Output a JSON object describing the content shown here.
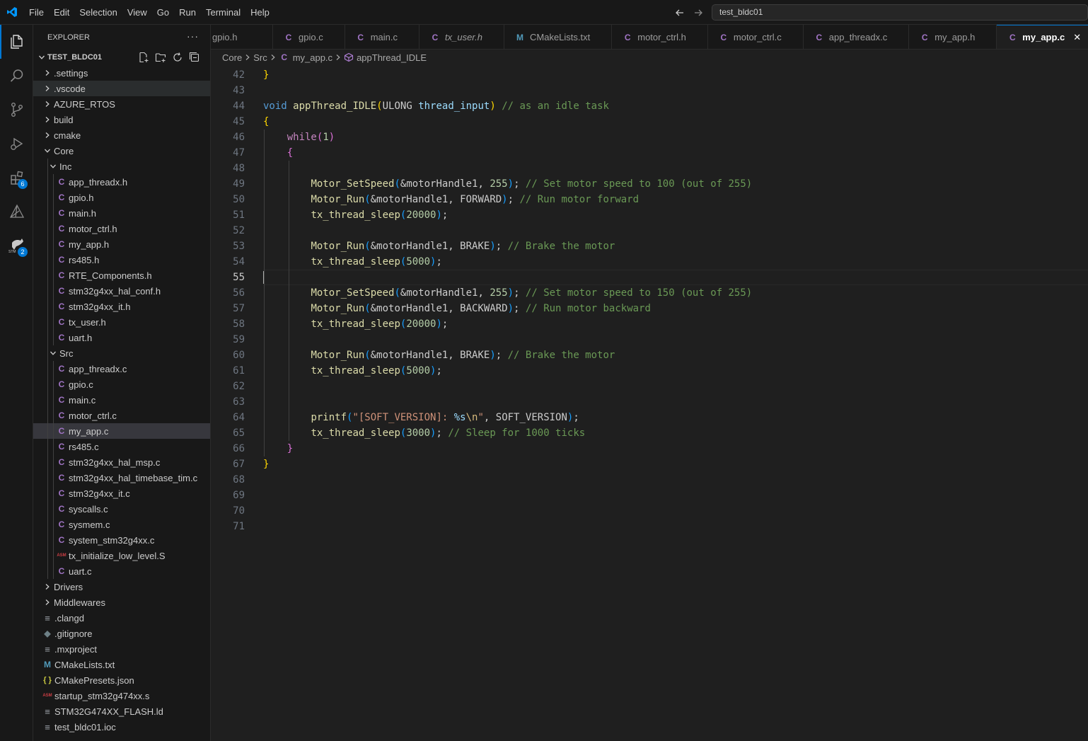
{
  "menu": [
    "File",
    "Edit",
    "Selection",
    "View",
    "Go",
    "Run",
    "Terminal",
    "Help"
  ],
  "search": {
    "value": "test_bldc01"
  },
  "activity": {
    "extensions_badge": "6",
    "stm_badge": "2"
  },
  "explorer": {
    "title": "EXPLORER",
    "more": "···",
    "root": "TEST_BLDC01",
    "items": [
      {
        "name": ".settings",
        "kind": "folder",
        "depth": 0,
        "open": false
      },
      {
        "name": ".vscode",
        "kind": "folder",
        "depth": 0,
        "open": false
      },
      {
        "name": "AZURE_RTOS",
        "kind": "folder",
        "depth": 0,
        "open": false
      },
      {
        "name": "build",
        "kind": "folder",
        "depth": 0,
        "open": false
      },
      {
        "name": "cmake",
        "kind": "folder",
        "depth": 0,
        "open": false
      },
      {
        "name": "Core",
        "kind": "folder",
        "depth": 0,
        "open": true
      },
      {
        "name": "Inc",
        "kind": "folder",
        "depth": 1,
        "open": true
      },
      {
        "name": "app_threadx.h",
        "kind": "c",
        "depth": 2
      },
      {
        "name": "gpio.h",
        "kind": "c",
        "depth": 2
      },
      {
        "name": "main.h",
        "kind": "c",
        "depth": 2
      },
      {
        "name": "motor_ctrl.h",
        "kind": "c",
        "depth": 2
      },
      {
        "name": "my_app.h",
        "kind": "c",
        "depth": 2
      },
      {
        "name": "rs485.h",
        "kind": "c",
        "depth": 2
      },
      {
        "name": "RTE_Components.h",
        "kind": "c",
        "depth": 2
      },
      {
        "name": "stm32g4xx_hal_conf.h",
        "kind": "c",
        "depth": 2
      },
      {
        "name": "stm32g4xx_it.h",
        "kind": "c",
        "depth": 2
      },
      {
        "name": "tx_user.h",
        "kind": "c",
        "depth": 2
      },
      {
        "name": "uart.h",
        "kind": "c",
        "depth": 2
      },
      {
        "name": "Src",
        "kind": "folder",
        "depth": 1,
        "open": true
      },
      {
        "name": "app_threadx.c",
        "kind": "c",
        "depth": 2
      },
      {
        "name": "gpio.c",
        "kind": "c",
        "depth": 2
      },
      {
        "name": "main.c",
        "kind": "c",
        "depth": 2
      },
      {
        "name": "motor_ctrl.c",
        "kind": "c",
        "depth": 2
      },
      {
        "name": "my_app.c",
        "kind": "c",
        "depth": 2,
        "selected": true
      },
      {
        "name": "rs485.c",
        "kind": "c",
        "depth": 2
      },
      {
        "name": "stm32g4xx_hal_msp.c",
        "kind": "c",
        "depth": 2
      },
      {
        "name": "stm32g4xx_hal_timebase_tim.c",
        "kind": "c",
        "depth": 2
      },
      {
        "name": "stm32g4xx_it.c",
        "kind": "c",
        "depth": 2
      },
      {
        "name": "syscalls.c",
        "kind": "c",
        "depth": 2
      },
      {
        "name": "sysmem.c",
        "kind": "c",
        "depth": 2
      },
      {
        "name": "system_stm32g4xx.c",
        "kind": "c",
        "depth": 2
      },
      {
        "name": "tx_initialize_low_level.S",
        "kind": "asm",
        "depth": 2
      },
      {
        "name": "uart.c",
        "kind": "c",
        "depth": 2
      },
      {
        "name": "Drivers",
        "kind": "folder",
        "depth": 0,
        "open": false
      },
      {
        "name": "Middlewares",
        "kind": "folder",
        "depth": 0,
        "open": false
      },
      {
        "name": ".clangd",
        "kind": "lines",
        "depth": 0
      },
      {
        "name": ".gitignore",
        "kind": "git",
        "depth": 0
      },
      {
        "name": ".mxproject",
        "kind": "lines",
        "depth": 0
      },
      {
        "name": "CMakeLists.txt",
        "kind": "m",
        "depth": 0
      },
      {
        "name": "CMakePresets.json",
        "kind": "json",
        "depth": 0
      },
      {
        "name": "startup_stm32g474xx.s",
        "kind": "asm",
        "depth": 0
      },
      {
        "name": "STM32G474XX_FLASH.ld",
        "kind": "lines",
        "depth": 0
      },
      {
        "name": "test_bldc01.ioc",
        "kind": "lines",
        "depth": 0
      }
    ]
  },
  "tabs": [
    {
      "label": "gpio.h",
      "kind": "none"
    },
    {
      "label": "gpio.c",
      "kind": "c"
    },
    {
      "label": "main.c",
      "kind": "c"
    },
    {
      "label": "tx_user.h",
      "kind": "c",
      "italic": true
    },
    {
      "label": "CMakeLists.txt",
      "kind": "m"
    },
    {
      "label": "motor_ctrl.h",
      "kind": "c"
    },
    {
      "label": "motor_ctrl.c",
      "kind": "c"
    },
    {
      "label": "app_threadx.c",
      "kind": "c"
    },
    {
      "label": "my_app.h",
      "kind": "c"
    },
    {
      "label": "my_app.c",
      "kind": "c",
      "active": true
    }
  ],
  "breadcrumb": [
    "Core",
    "Src",
    "my_app.c",
    "appThread_IDLE"
  ],
  "editor": {
    "current_line": 55,
    "lines": [
      {
        "n": "42",
        "tokens": [
          [
            "p1",
            "}"
          ]
        ]
      },
      {
        "n": "43",
        "tokens": []
      },
      {
        "n": "44",
        "tokens": [
          [
            "kw",
            "void"
          ],
          [
            "",
            " "
          ],
          [
            "fn",
            "appThread_IDLE"
          ],
          [
            "p1",
            "("
          ],
          [
            "",
            "ULONG "
          ],
          [
            "var",
            "thread_input"
          ],
          [
            "p1",
            ")"
          ],
          [
            "",
            " "
          ],
          [
            "cmt",
            "// as an idle task"
          ]
        ]
      },
      {
        "n": "45",
        "tokens": [
          [
            "p1",
            "{"
          ]
        ]
      },
      {
        "n": "46",
        "tokens": [
          [
            "",
            "    "
          ],
          [
            "ctrl",
            "while"
          ],
          [
            "p2",
            "("
          ],
          [
            "num",
            "1"
          ],
          [
            "p2",
            ")"
          ]
        ]
      },
      {
        "n": "47",
        "tokens": [
          [
            "",
            "    "
          ],
          [
            "p2",
            "{"
          ]
        ]
      },
      {
        "n": "48",
        "tokens": []
      },
      {
        "n": "49",
        "tokens": [
          [
            "",
            "        "
          ],
          [
            "fn",
            "Motor_SetSpeed"
          ],
          [
            "p3",
            "("
          ],
          [
            "",
            "&motorHandle1, "
          ],
          [
            "num",
            "255"
          ],
          [
            "p3",
            ")"
          ],
          [
            "",
            "; "
          ],
          [
            "cmt",
            "// Set motor speed to 100 (out of 255)"
          ]
        ]
      },
      {
        "n": "50",
        "tokens": [
          [
            "",
            "        "
          ],
          [
            "fn",
            "Motor_Run"
          ],
          [
            "p3",
            "("
          ],
          [
            "",
            "&motorHandle1, FORWARD"
          ],
          [
            "p3",
            ")"
          ],
          [
            "",
            "; "
          ],
          [
            "cmt",
            "// Run motor forward"
          ]
        ]
      },
      {
        "n": "51",
        "tokens": [
          [
            "",
            "        "
          ],
          [
            "fn",
            "tx_thread_sleep"
          ],
          [
            "p3",
            "("
          ],
          [
            "num",
            "20000"
          ],
          [
            "p3",
            ")"
          ],
          [
            "",
            ";"
          ]
        ]
      },
      {
        "n": "52",
        "tokens": []
      },
      {
        "n": "53",
        "tokens": [
          [
            "",
            "        "
          ],
          [
            "fn",
            "Motor_Run"
          ],
          [
            "p3",
            "("
          ],
          [
            "",
            "&motorHandle1, BRAKE"
          ],
          [
            "p3",
            ")"
          ],
          [
            "",
            "; "
          ],
          [
            "cmt",
            "// Brake the motor"
          ]
        ]
      },
      {
        "n": "54",
        "tokens": [
          [
            "",
            "        "
          ],
          [
            "fn",
            "tx_thread_sleep"
          ],
          [
            "p3",
            "("
          ],
          [
            "num",
            "5000"
          ],
          [
            "p3",
            ")"
          ],
          [
            "",
            ";"
          ]
        ]
      },
      {
        "n": "55",
        "tokens": []
      },
      {
        "n": "56",
        "tokens": [
          [
            "",
            "        "
          ],
          [
            "fn",
            "Motor_SetSpeed"
          ],
          [
            "p3",
            "("
          ],
          [
            "",
            "&motorHandle1, "
          ],
          [
            "num",
            "255"
          ],
          [
            "p3",
            ")"
          ],
          [
            "",
            "; "
          ],
          [
            "cmt",
            "// Set motor speed to 150 (out of 255)"
          ]
        ]
      },
      {
        "n": "57",
        "tokens": [
          [
            "",
            "        "
          ],
          [
            "fn",
            "Motor_Run"
          ],
          [
            "p3",
            "("
          ],
          [
            "",
            "&motorHandle1, BACKWARD"
          ],
          [
            "p3",
            ")"
          ],
          [
            "",
            "; "
          ],
          [
            "cmt",
            "// Run motor backward"
          ]
        ]
      },
      {
        "n": "58",
        "tokens": [
          [
            "",
            "        "
          ],
          [
            "fn",
            "tx_thread_sleep"
          ],
          [
            "p3",
            "("
          ],
          [
            "num",
            "20000"
          ],
          [
            "p3",
            ")"
          ],
          [
            "",
            ";"
          ]
        ]
      },
      {
        "n": "59",
        "tokens": []
      },
      {
        "n": "60",
        "tokens": [
          [
            "",
            "        "
          ],
          [
            "fn",
            "Motor_Run"
          ],
          [
            "p3",
            "("
          ],
          [
            "",
            "&motorHandle1, BRAKE"
          ],
          [
            "p3",
            ")"
          ],
          [
            "",
            "; "
          ],
          [
            "cmt",
            "// Brake the motor"
          ]
        ]
      },
      {
        "n": "61",
        "tokens": [
          [
            "",
            "        "
          ],
          [
            "fn",
            "tx_thread_sleep"
          ],
          [
            "p3",
            "("
          ],
          [
            "num",
            "5000"
          ],
          [
            "p3",
            ")"
          ],
          [
            "",
            ";"
          ]
        ]
      },
      {
        "n": "62",
        "tokens": []
      },
      {
        "n": "63",
        "tokens": []
      },
      {
        "n": "64",
        "tokens": [
          [
            "",
            "        "
          ],
          [
            "fn",
            "printf"
          ],
          [
            "p3",
            "("
          ],
          [
            "str",
            "\"[SOFT_VERSION]: "
          ],
          [
            "var",
            "%s"
          ],
          [
            "esc",
            "\\n"
          ],
          [
            "str",
            "\""
          ],
          [
            "",
            ", SOFT_VERSION"
          ],
          [
            "p3",
            ")"
          ],
          [
            "",
            ";"
          ]
        ]
      },
      {
        "n": "65",
        "tokens": [
          [
            "",
            "        "
          ],
          [
            "fn",
            "tx_thread_sleep"
          ],
          [
            "p3",
            "("
          ],
          [
            "num",
            "3000"
          ],
          [
            "p3",
            ")"
          ],
          [
            "",
            "; "
          ],
          [
            "cmt",
            "// Sleep for 1000 ticks"
          ]
        ]
      },
      {
        "n": "66",
        "tokens": [
          [
            "",
            "    "
          ],
          [
            "p2",
            "}"
          ]
        ]
      },
      {
        "n": "67",
        "tokens": [
          [
            "p1",
            "}"
          ]
        ]
      },
      {
        "n": "68",
        "tokens": []
      },
      {
        "n": "69",
        "tokens": []
      },
      {
        "n": "70",
        "tokens": []
      },
      {
        "n": "71",
        "tokens": []
      }
    ]
  },
  "colors": {
    "accent": "#0078d4",
    "c_icon": "#a074c4",
    "cmake_icon": "#519aba"
  }
}
